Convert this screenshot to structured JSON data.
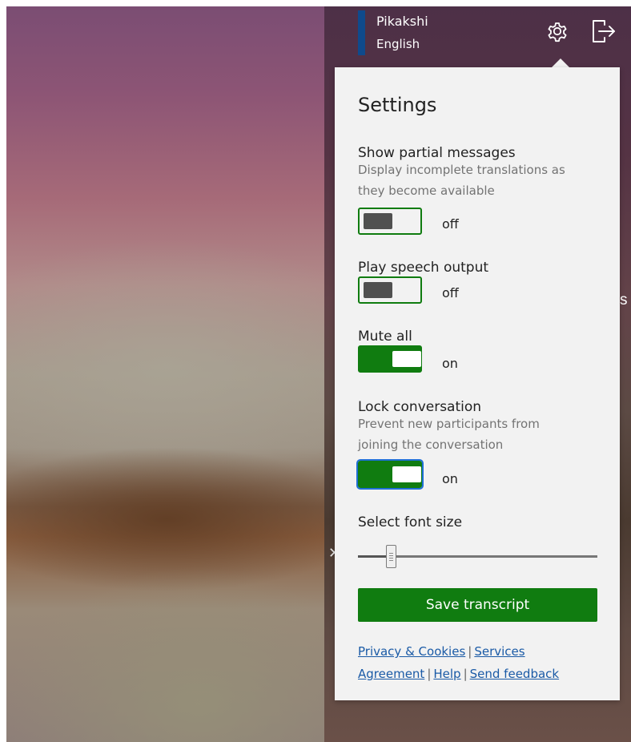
{
  "user": {
    "name": "Pikakshi",
    "language": "English",
    "accent_color": "#0f4a8c"
  },
  "header": {
    "settings_icon": "gear-icon",
    "signout_icon": "sign-out-icon"
  },
  "settings": {
    "title": "Settings",
    "partial_messages": {
      "label": "Show partial messages",
      "description_line1": "Display incomplete translations as",
      "description_line2": "they become available",
      "on": false,
      "state_text": "off"
    },
    "speech_output": {
      "label": "Play speech output",
      "on": false,
      "state_text": "off"
    },
    "mute_all": {
      "label": "Mute all",
      "on": true,
      "state_text": "on"
    },
    "lock_conversation": {
      "label": "Lock conversation",
      "description_line1": "Prevent new participants from",
      "description_line2": "joining the conversation",
      "on": true,
      "state_text": "on"
    },
    "font_size": {
      "label": "Select font size",
      "level": 0.14
    },
    "save_button": "Save transcript",
    "accent_color": "#107c10"
  },
  "footer": {
    "privacy": "Privacy & Cookies",
    "services_part1": "Services",
    "services_part2": "Agreement",
    "help": "Help",
    "feedback": "Send feedback",
    "separator": "|"
  },
  "background": {
    "stray_right": "s"
  }
}
